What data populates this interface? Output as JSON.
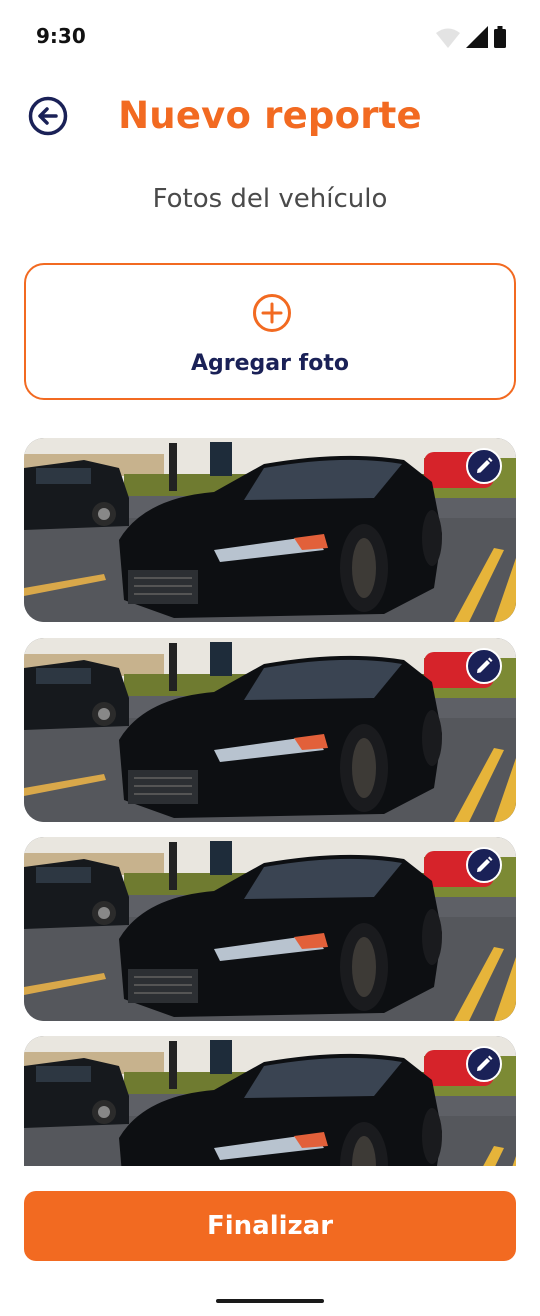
{
  "status_bar": {
    "time": "9:30"
  },
  "header": {
    "title": "Nuevo reporte"
  },
  "section": {
    "subtitle": "Fotos del vehículo"
  },
  "add_photo": {
    "label": "Agregar foto"
  },
  "photos": [
    {
      "subject": "black sedan car photo"
    },
    {
      "subject": "black sedan car photo"
    },
    {
      "subject": "black sedan car photo"
    },
    {
      "subject": "black sedan car photo"
    }
  ],
  "footer": {
    "finalize_label": "Finalizar"
  },
  "colors": {
    "accent": "#f26a21",
    "navy": "#1a2157",
    "text_gray": "#4a4a4a"
  },
  "icons": [
    "back-arrow-icon",
    "plus-circle-icon",
    "edit-pencil-icon",
    "wifi-icon",
    "signal-icon",
    "battery-icon"
  ]
}
